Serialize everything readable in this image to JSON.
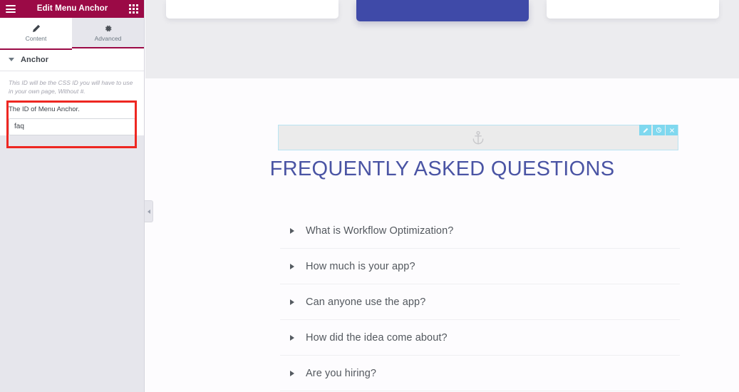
{
  "panel": {
    "header": {
      "title": "Edit Menu Anchor",
      "menu_icon": "hamburger-icon",
      "widgets_icon": "grid-icon"
    },
    "tabs": [
      {
        "label": "Content",
        "icon": "pencil-icon",
        "active": true
      },
      {
        "label": "Advanced",
        "icon": "gear-icon",
        "active": false
      }
    ],
    "section": {
      "title": "Anchor",
      "collapsed": false,
      "helper_text": "This ID will be the CSS ID you will have to use in your own page, Without #.",
      "field_label": "The ID of Menu Anchor.",
      "field_value": "faq",
      "field_placeholder": ""
    },
    "annotation": {
      "color": "#ee2722",
      "shape": "rectangle-highlight"
    },
    "collapse_handle_icon": "chevron-left-icon"
  },
  "canvas": {
    "top_cards": [
      {
        "name": "pricing-card-left",
        "featured": false
      },
      {
        "name": "pricing-card-center",
        "featured": true
      },
      {
        "name": "pricing-card-right",
        "featured": false
      }
    ],
    "anchor_widget": {
      "icon": "anchor-icon",
      "tools": [
        {
          "name": "edit-widget-button",
          "icon": "pencil-icon"
        },
        {
          "name": "duplicate-widget-button",
          "icon": "duplicate-icon"
        },
        {
          "name": "remove-widget-button",
          "icon": "close-icon"
        }
      ]
    },
    "faq": {
      "title": "FREQUENTLY ASKED QUESTIONS",
      "items": [
        {
          "question": "What is Workflow Optimization?"
        },
        {
          "question": "How much is your app?"
        },
        {
          "question": "Can anyone use the app?"
        },
        {
          "question": "How did the idea come about?"
        },
        {
          "question": "Are you hiring?"
        }
      ]
    }
  },
  "colors": {
    "panel_header": "#9b0a46",
    "panel_bg": "#e6e6ec",
    "accent": "#9b0a46",
    "annotation_red": "#ee2722",
    "widget_outline": "#b9e4f2",
    "tool_button": "#7fd8ef",
    "faq_heading": "#4a54a4",
    "featured_card": "#3f4aa8"
  }
}
